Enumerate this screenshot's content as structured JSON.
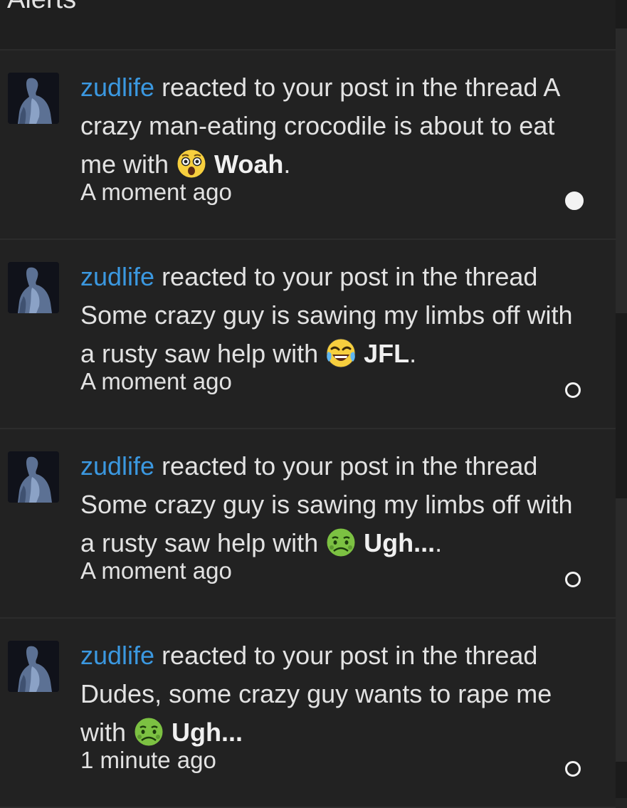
{
  "header": {
    "title": "Alerts"
  },
  "alerts": [
    {
      "user": "zudlife",
      "action": " reacted to your post in the thread ",
      "thread": "A crazy man-eating crocodile is about to eat me",
      "with": " with ",
      "reaction": "Woah",
      "reaction_icon": "astonished-emoji-icon",
      "period": ".",
      "time": "A moment ago",
      "unread": true
    },
    {
      "user": "zudlife",
      "action": " reacted to your post in the thread ",
      "thread": "Some crazy guy is sawing my limbs off with a rusty saw help",
      "with": " with ",
      "reaction": "JFL",
      "reaction_icon": "crying-laughing-emoji-icon",
      "period": ".",
      "time": "A moment ago",
      "unread": false
    },
    {
      "user": "zudlife",
      "action": " reacted to your post in the thread ",
      "thread": "Some crazy guy is sawing my limbs off with a rusty saw help",
      "with": " with ",
      "reaction": "Ugh...",
      "reaction_icon": "nauseated-emoji-icon",
      "period": ".",
      "time": "A moment ago",
      "unread": false
    },
    {
      "user": "zudlife",
      "action": " reacted to your post in the thread ",
      "thread": "Dudes, some crazy guy wants to rape me",
      "with": " with ",
      "reaction": "Ugh...",
      "reaction_icon": "nauseated-emoji-icon",
      "period": "",
      "time": "1 minute ago",
      "unread": false
    }
  ],
  "colors": {
    "background": "#242424",
    "username_link": "#3b98e0",
    "text": "#e2e2e2"
  }
}
